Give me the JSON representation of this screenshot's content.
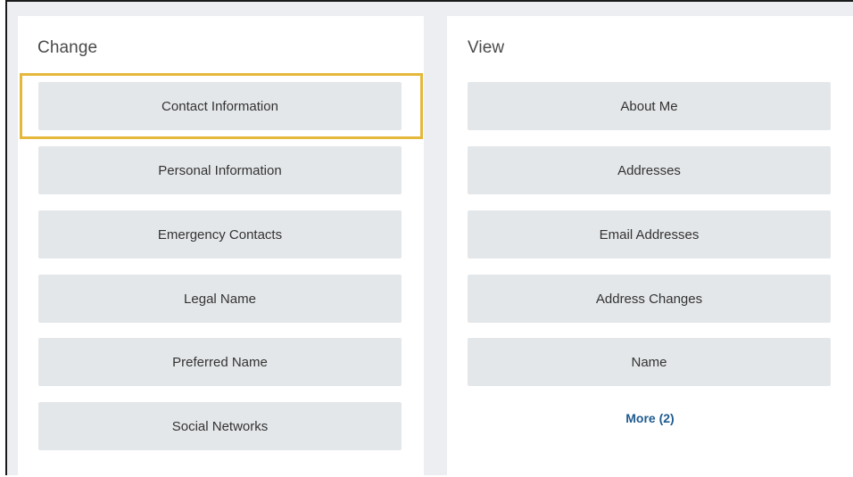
{
  "change": {
    "title": "Change",
    "items": [
      {
        "label": "Contact Information"
      },
      {
        "label": "Personal Information"
      },
      {
        "label": "Emergency Contacts"
      },
      {
        "label": "Legal Name"
      },
      {
        "label": "Preferred Name"
      },
      {
        "label": "Social Networks"
      }
    ]
  },
  "view": {
    "title": "View",
    "items": [
      {
        "label": "About Me"
      },
      {
        "label": "Addresses"
      },
      {
        "label": "Email Addresses"
      },
      {
        "label": "Address Changes"
      },
      {
        "label": "Name"
      }
    ],
    "more_label": "More (2)"
  },
  "colors": {
    "highlight": "#e5b83b",
    "button_bg": "#e4e7e9",
    "link": "#1f5b8f",
    "background": "#eceef1"
  }
}
